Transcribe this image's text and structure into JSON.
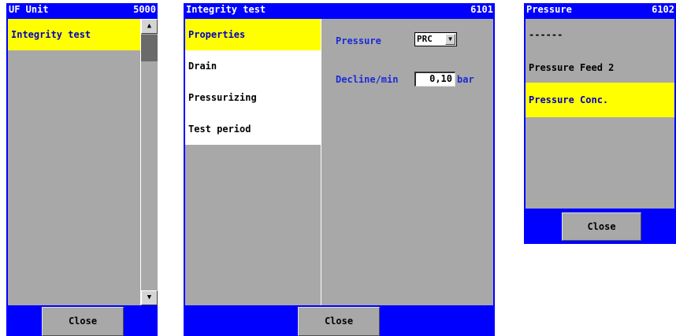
{
  "panel1": {
    "title": "UF Unit",
    "code": "5000",
    "items": [
      {
        "label": "Integrity test",
        "selected": true
      }
    ],
    "scroll_up_icon": "triangle-up",
    "scroll_down_icon": "triangle-down",
    "close_label": "Close"
  },
  "panel2": {
    "title": "Integrity test",
    "code": "6101",
    "menu": [
      {
        "label": "Properties",
        "selected": true
      },
      {
        "label": "Drain"
      },
      {
        "label": "Pressurizing"
      },
      {
        "label": "Test period"
      }
    ],
    "pressure_label": "Pressure",
    "pressure_value": "PRC",
    "dropdown_icon": "triangle-down",
    "decline_label": "Decline/min",
    "decline_value": "0,10",
    "decline_unit": "bar",
    "close_label": "Close"
  },
  "panel3": {
    "title": "Pressure",
    "code": "6102",
    "options": [
      {
        "label": "------"
      },
      {
        "label": "Pressure Feed 2"
      },
      {
        "label": "Pressure Conc.",
        "selected": true
      }
    ],
    "close_label": "Close"
  },
  "colors": {
    "panel_blue": "#0000ff",
    "selection_yellow": "#ffff00",
    "field_gray": "#a8a8a8",
    "label_blue": "#1a2bd6"
  }
}
